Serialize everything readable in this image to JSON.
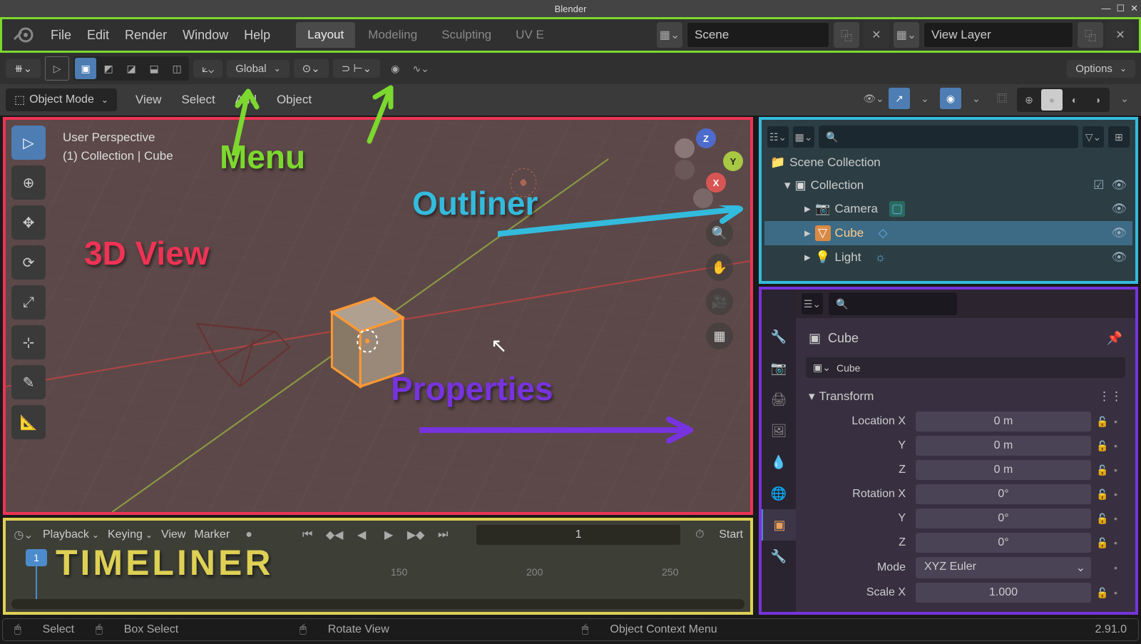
{
  "title": "Blender",
  "menu": {
    "items": [
      "File",
      "Edit",
      "Render",
      "Window",
      "Help"
    ]
  },
  "workspaces": {
    "active": "Layout",
    "tabs": [
      "Layout",
      "Modeling",
      "Sculpting",
      "UV E"
    ]
  },
  "scene_selector": {
    "label": "Scene"
  },
  "layer_selector": {
    "label": "View Layer"
  },
  "toolbar": {
    "orientation": "Global",
    "options_label": "Options"
  },
  "header": {
    "mode": "Object Mode",
    "menus": [
      "View",
      "Select",
      "Add",
      "Object"
    ]
  },
  "viewport": {
    "info_line1": "User Perspective",
    "info_line2": "(1) Collection | Cube",
    "axes": {
      "x": "X",
      "y": "Y",
      "z": "Z"
    }
  },
  "outliner": {
    "root": "Scene Collection",
    "collection": "Collection",
    "items": [
      {
        "name": "Camera",
        "type": "camera"
      },
      {
        "name": "Cube",
        "type": "mesh",
        "selected": true
      },
      {
        "name": "Light",
        "type": "light"
      }
    ]
  },
  "properties": {
    "object_name": "Cube",
    "data_block": "Cube",
    "transform_label": "Transform",
    "location": {
      "label": "Location X",
      "x": "0 m",
      "y": "0 m",
      "z": "0 m",
      "ylabel": "Y",
      "zlabel": "Z"
    },
    "rotation": {
      "label": "Rotation X",
      "x": "0°",
      "y": "0°",
      "z": "0°",
      "ylabel": "Y",
      "zlabel": "Z"
    },
    "mode_label": "Mode",
    "mode_value": "XYZ Euler",
    "scale": {
      "label": "Scale X",
      "x": "1.000"
    }
  },
  "timeline": {
    "menus": [
      "Playback",
      "Keying",
      "View",
      "Marker"
    ],
    "frame": "1",
    "start_label": "Start",
    "ruler_marks": [
      "150",
      "200",
      "250"
    ],
    "current": "1"
  },
  "statusbar": {
    "select": "Select",
    "box_select": "Box Select",
    "rotate": "Rotate View",
    "context_menu": "Object Context Menu",
    "version": "2.91.0"
  },
  "annotations": {
    "menu": "Menu",
    "outliner": "Outliner",
    "view3d": "3D View",
    "properties": "Properties",
    "timeliner": "TIMELINER"
  }
}
